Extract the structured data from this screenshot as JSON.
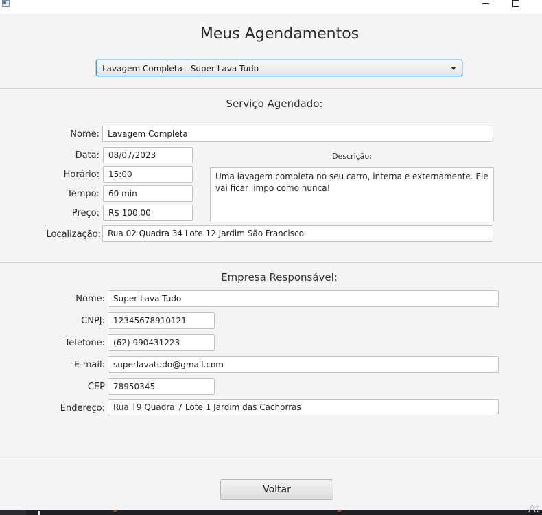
{
  "page": {
    "title": "Meus Agendamentos"
  },
  "selector": {
    "selected": "Lavagem Completa - Super Lava Tudo"
  },
  "servico": {
    "heading": "Serviço Agendado:",
    "nome_label": "Nome:",
    "nome": "Lavagem Completa",
    "data_label": "Data:",
    "data": "08/07/2023",
    "horario_label": "Horário:",
    "horario": "15:00",
    "tempo_label": "Tempo:",
    "tempo": "60 min",
    "preco_label": "Preço:",
    "preco": "R$ 100,00",
    "descricao_label": "Descrição:",
    "descricao": "Uma lavagem completa no seu carro, interna e externamente. Ele vai ficar limpo como nunca!",
    "localizacao_label": "Localização:",
    "localizacao": "Rua 02 Quadra 34 Lote 12 Jardim São Francisco"
  },
  "empresa": {
    "heading": "Empresa Responsável:",
    "nome_label": "Nome:",
    "nome": "Super Lava Tudo",
    "cnpj_label": "CNPJ:",
    "cnpj": "12345678910121",
    "telefone_label": "Telefone:",
    "telefone": "(62) 990431223",
    "email_label": "E-mail:",
    "email": "superlavatudo@gmail.com",
    "cep_label": "CEP",
    "cep": "78950345",
    "endereco_label": "Endereço:",
    "endereco": "Rua T9 Quadra 7 Lote 1 Jardim das Cachorras"
  },
  "actions": {
    "voltar": "Voltar"
  },
  "overlay": {
    "watermark": "At"
  },
  "colors": {
    "focus_accent": "#3c9ae0",
    "background": "#f4f4f4"
  },
  "icons": {
    "app": "app-window-icon",
    "minimize": "minimize-icon",
    "maximize": "maximize-icon",
    "dropdown": "chevron-down-icon"
  }
}
